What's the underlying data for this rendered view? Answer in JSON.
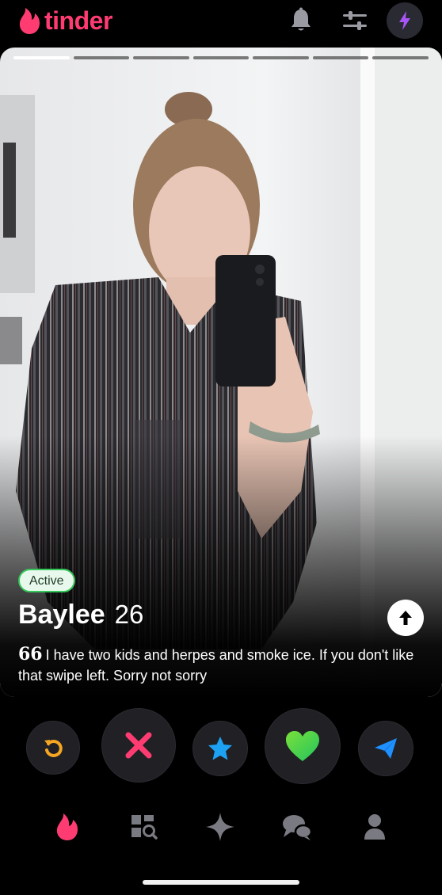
{
  "app": {
    "logo_text": "tinder",
    "brand_color": "#fe3c72"
  },
  "header": {
    "icons": [
      "bell-icon",
      "filter-sliders-icon",
      "boost-bolt-icon"
    ]
  },
  "card": {
    "photo_count": 7,
    "current_photo": 1,
    "active_label": "Active",
    "name": "Baylee",
    "age": "26",
    "bio": "I have two kids and herpes and smoke ice. If you don't like that swipe left. Sorry not sorry",
    "bio_quote_mark": "66"
  },
  "actions": [
    {
      "name": "rewind",
      "icon": "rewind-icon",
      "color": "#f5a623"
    },
    {
      "name": "nope",
      "icon": "x-icon",
      "color": "#fe3c72"
    },
    {
      "name": "super-like",
      "icon": "star-icon",
      "color": "#1da1f2"
    },
    {
      "name": "like",
      "icon": "heart-icon",
      "color": "#4cd964"
    },
    {
      "name": "boost",
      "icon": "send-icon",
      "color": "#1e90ff"
    }
  ],
  "nav": [
    {
      "name": "discover",
      "icon": "flame-icon",
      "active": true
    },
    {
      "name": "explore",
      "icon": "grid-search-icon",
      "active": false
    },
    {
      "name": "gold",
      "icon": "sparkle-icon",
      "active": false
    },
    {
      "name": "messages",
      "icon": "chat-bubbles-icon",
      "active": false
    },
    {
      "name": "profile",
      "icon": "person-icon",
      "active": false
    }
  ]
}
